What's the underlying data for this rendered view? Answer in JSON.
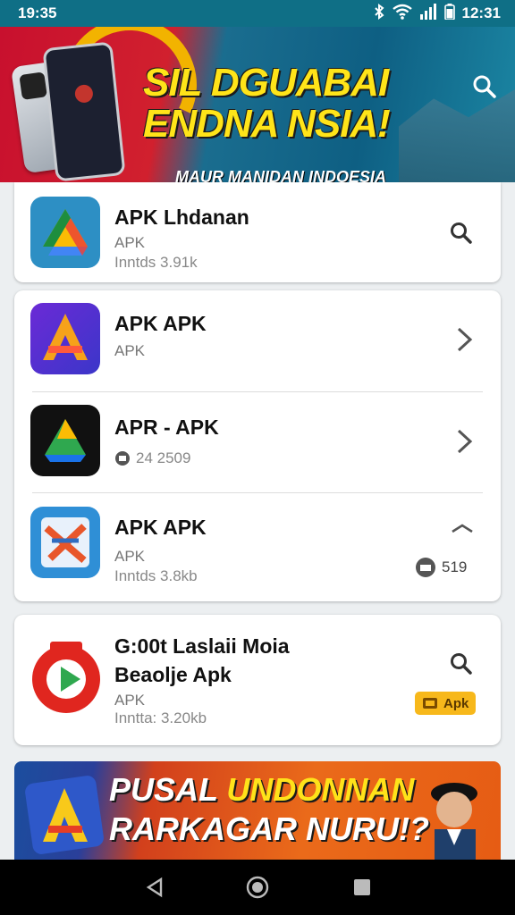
{
  "status_bar": {
    "time": "19:35",
    "clock_right": "12:31"
  },
  "banner": {
    "title_line1": "SIL DGUABAI",
    "title_line2": "ENDNA NSIA!",
    "subtitle": "MAUR MANIDAN INDOESIA"
  },
  "cards": [
    {
      "items": [
        {
          "title": "APK Lhdanan",
          "subtitle": "APK",
          "meta": "Inntds 3.91k",
          "icon": "drive-triangle-icon",
          "action": "search-icon"
        }
      ]
    },
    {
      "items": [
        {
          "title": "APK APK",
          "subtitle": "APK",
          "meta": "",
          "icon": "purple-a-icon",
          "action": "chevron-right-icon"
        },
        {
          "title": "APR - APK",
          "subtitle": "",
          "meta": "24 2509",
          "icon": "dark-drive-icon",
          "action": "chevron-right-icon"
        },
        {
          "title": "APK APK",
          "subtitle": "APK",
          "meta": "Inntds 3.8kb",
          "icon": "blue-x-icon",
          "action": "chevron-up-icon",
          "badge": "519"
        }
      ]
    },
    {
      "items": [
        {
          "title": "G:00t Laslaii Moia",
          "title2": "Beaolje Apk",
          "subtitle": "APK",
          "meta": "Inntta: 3.20kb",
          "icon": "red-circle-icon",
          "action": "search-icon",
          "tag": "Apk"
        }
      ]
    }
  ],
  "ad_banner": {
    "line1": "PUSAL",
    "line1_highlight": "UNDONNAN",
    "line2": "RARKAGAR NURU!?"
  },
  "colors": {
    "status_bar": "#0f6f86",
    "banner_yellow": "#ffe419",
    "tag_yellow": "#f7b81b"
  }
}
